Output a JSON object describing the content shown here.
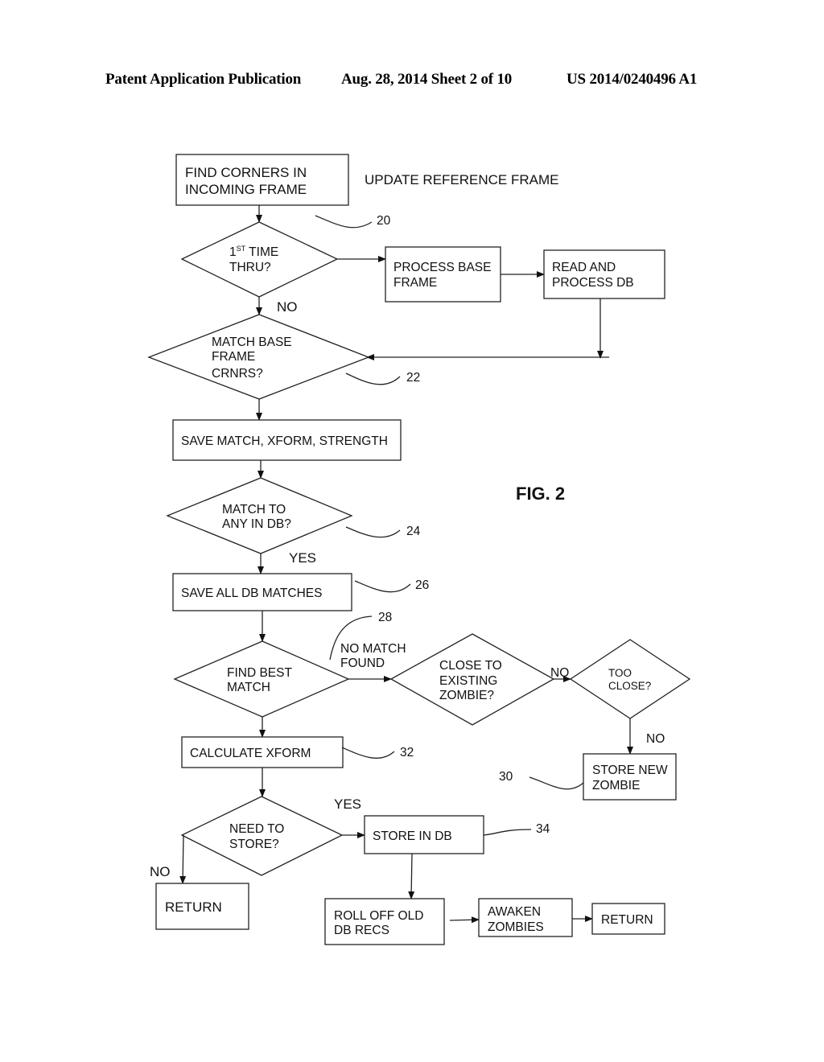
{
  "header": {
    "left": "Patent Application Publication",
    "center": "Aug. 28, 2014  Sheet 2 of 10",
    "right": "US 2014/0240496 A1"
  },
  "figure": {
    "label": "FIG. 2",
    "caption": "UPDATE REFERENCE FRAME"
  },
  "nodes": {
    "find_corners": [
      "FIND CORNERS IN",
      "INCOMING  FRAME"
    ],
    "first_time": [
      "1",
      "ST",
      " TIME",
      "THRU?"
    ],
    "process_base": [
      "PROCESS BASE",
      "FRAME"
    ],
    "read_db": [
      "READ AND",
      "PROCESS DB"
    ],
    "match_base": [
      "MATCH BASE",
      "FRAME",
      "CRNRS?"
    ],
    "save_match": [
      "SAVE MATCH, XFORM, STRENGTH"
    ],
    "match_any": [
      "MATCH TO",
      "ANY IN DB?"
    ],
    "save_all": [
      "SAVE ALL  DB MATCHES"
    ],
    "find_best": [
      "FIND BEST",
      "MATCH"
    ],
    "close_zombie": [
      "CLOSE TO",
      "EXISTING",
      "ZOMBIE?"
    ],
    "too_close": [
      "TOO",
      "CLOSE?"
    ],
    "store_zombie": [
      "STORE NEW",
      "ZOMBIE"
    ],
    "calc_xform": [
      "CALCULATE  XFORM"
    ],
    "need_store": [
      "NEED TO",
      "STORE?"
    ],
    "store_db": [
      "STORE IN DB"
    ],
    "return1": [
      "RETURN"
    ],
    "roll_off": [
      "ROLL OFF OLD",
      "DB RECS"
    ],
    "awaken": [
      "AWAKEN",
      "ZOMBIES"
    ],
    "return2": [
      "RETURN"
    ]
  },
  "edge_labels": {
    "first_no": "NO",
    "match_yes": "YES",
    "no_match_found": [
      "NO MATCH",
      "FOUND"
    ],
    "zombie_no": "NO",
    "too_close_no": "NO",
    "store_yes": "YES",
    "store_no": "NO"
  },
  "refs": {
    "r20": "20",
    "r22": "22",
    "r24": "24",
    "r26": "26",
    "r28": "28",
    "r30": "30",
    "r32": "32",
    "r34": "34"
  }
}
